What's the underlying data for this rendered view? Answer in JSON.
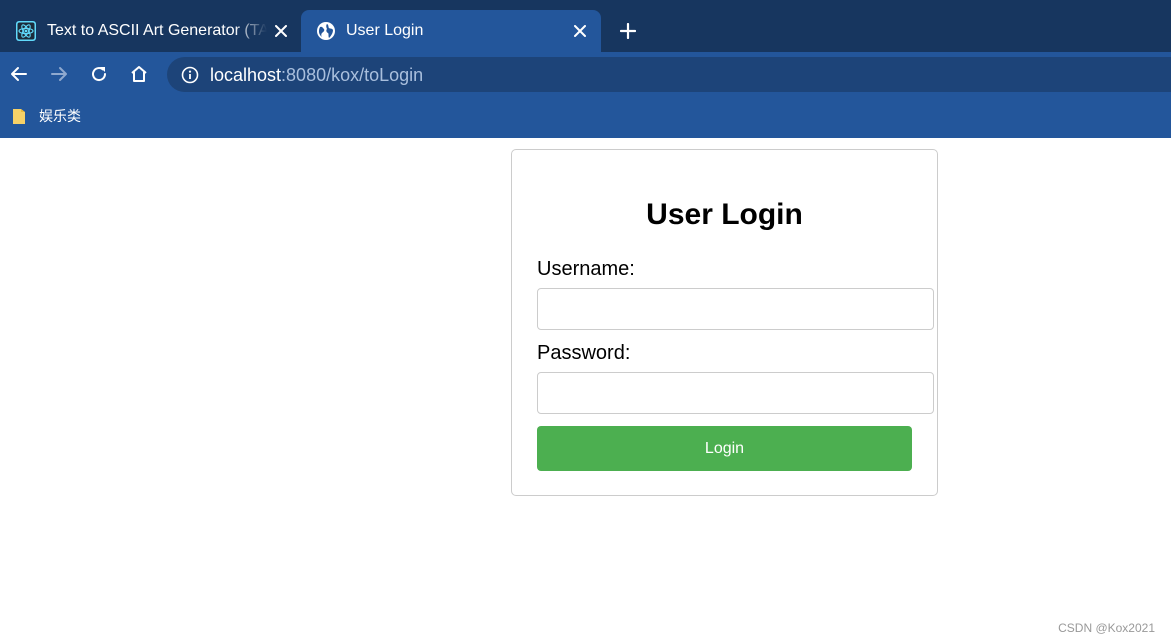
{
  "tabs": [
    {
      "title": "Text to ASCII Art Generator (TAAG)",
      "favicon": "react-atom-icon",
      "active": false
    },
    {
      "title": "User Login",
      "favicon": "globe-icon",
      "active": true
    }
  ],
  "toolbar": {
    "url_host": "localhost",
    "url_path": ":8080/kox/toLogin"
  },
  "bookmarks": [
    {
      "label": "娱乐类",
      "icon": "folder-icon"
    }
  ],
  "login": {
    "title": "User Login",
    "username_label": "Username:",
    "username_value": "",
    "password_label": "Password:",
    "password_value": "",
    "button_label": "Login"
  },
  "watermark": "CSDN @Kox2021",
  "colors": {
    "tabstrip": "#17365f",
    "toolbar": "#23569b",
    "omnibox": "#1d4479",
    "login_button": "#4caf50"
  }
}
